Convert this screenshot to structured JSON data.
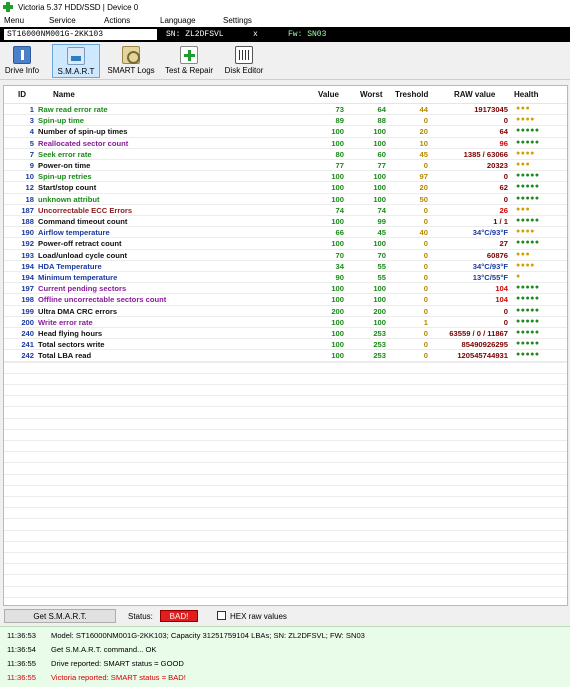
{
  "window": {
    "title": "Victoria 5.37 HDD/SSD | Device 0"
  },
  "menu": [
    "Menu",
    "Service",
    "Actions",
    "Language",
    "Settings"
  ],
  "device_bar": {
    "model": "ST16000NM001G-2KK103",
    "sn": "SN: ZL2DFSVL",
    "close": "x",
    "fw": "Fw: SN03"
  },
  "toolbar": [
    {
      "label": "Drive Info",
      "icon": "drive-icon",
      "active": false
    },
    {
      "label": "S.M.A.R.T",
      "icon": "smart-icon",
      "active": true
    },
    {
      "label": "SMART Logs",
      "icon": "logs-icon",
      "active": false
    },
    {
      "label": "Test & Repair",
      "icon": "repair-icon",
      "active": false
    },
    {
      "label": "Disk Editor",
      "icon": "editor-icon",
      "active": false
    }
  ],
  "columns": [
    "ID",
    "Name",
    "Value",
    "Worst",
    "Treshold",
    "RAW value",
    "Health"
  ],
  "colors": {
    "green": "#1a8a1a",
    "darkred": "#8b1a1a",
    "black": "#111111",
    "purple": "#8a1a9a",
    "blue": "#1a3aa0",
    "health_green": "#1a8a1a",
    "health_yellow": "#d4a000",
    "raw_default": "#7a0000",
    "raw_red": "#d40000",
    "raw_blue": "#1a3aa0"
  },
  "attributes": [
    {
      "id": "1",
      "name": "Raw read error rate",
      "value": "73",
      "worst": "64",
      "threshold": "44",
      "raw": "19173045",
      "health": "●●●",
      "name_color": "green",
      "raw_color": "raw_default",
      "health_color": "health_yellow"
    },
    {
      "id": "3",
      "name": "Spin-up time",
      "value": "89",
      "worst": "88",
      "threshold": "0",
      "raw": "0",
      "health": "●●●●",
      "name_color": "green",
      "raw_color": "raw_default",
      "health_color": "health_yellow"
    },
    {
      "id": "4",
      "name": "Number of spin-up times",
      "value": "100",
      "worst": "100",
      "threshold": "20",
      "raw": "64",
      "health": "●●●●●",
      "name_color": "black",
      "raw_color": "raw_default",
      "health_color": "health_green"
    },
    {
      "id": "5",
      "name": "Reallocated sector count",
      "value": "100",
      "worst": "100",
      "threshold": "10",
      "raw": "96",
      "health": "●●●●●",
      "name_color": "purple",
      "raw_color": "raw_red",
      "health_color": "health_green"
    },
    {
      "id": "7",
      "name": "Seek error rate",
      "value": "80",
      "worst": "60",
      "threshold": "45",
      "raw": "1385 / 63066",
      "health": "●●●●",
      "name_color": "green",
      "raw_color": "raw_default",
      "health_color": "health_yellow"
    },
    {
      "id": "9",
      "name": "Power-on time",
      "value": "77",
      "worst": "77",
      "threshold": "0",
      "raw": "20323",
      "health": "●●●",
      "name_color": "black",
      "raw_color": "raw_default",
      "health_color": "health_yellow"
    },
    {
      "id": "10",
      "name": "Spin-up retries",
      "value": "100",
      "worst": "100",
      "threshold": "97",
      "raw": "0",
      "health": "●●●●●",
      "name_color": "green",
      "raw_color": "raw_default",
      "health_color": "health_green"
    },
    {
      "id": "12",
      "name": "Start/stop count",
      "value": "100",
      "worst": "100",
      "threshold": "20",
      "raw": "62",
      "health": "●●●●●",
      "name_color": "black",
      "raw_color": "raw_default",
      "health_color": "health_green"
    },
    {
      "id": "18",
      "name": "unknown attribut",
      "value": "100",
      "worst": "100",
      "threshold": "50",
      "raw": "0",
      "health": "●●●●●",
      "name_color": "green",
      "raw_color": "raw_default",
      "health_color": "health_green"
    },
    {
      "id": "187",
      "name": "Uncorrectable ECC Errors",
      "value": "74",
      "worst": "74",
      "threshold": "0",
      "raw": "26",
      "health": "●●●",
      "name_color": "darkred",
      "raw_color": "raw_red",
      "health_color": "health_yellow"
    },
    {
      "id": "188",
      "name": "Command timeout count",
      "value": "100",
      "worst": "99",
      "threshold": "0",
      "raw": "1 / 1",
      "health": "●●●●●",
      "name_color": "black",
      "raw_color": "raw_default",
      "health_color": "health_green"
    },
    {
      "id": "190",
      "name": "Airflow temperature",
      "value": "66",
      "worst": "45",
      "threshold": "40",
      "raw": "34°C/93°F",
      "health": "●●●●",
      "name_color": "blue",
      "raw_color": "raw_blue",
      "health_color": "health_yellow"
    },
    {
      "id": "192",
      "name": "Power-off retract count",
      "value": "100",
      "worst": "100",
      "threshold": "0",
      "raw": "27",
      "health": "●●●●●",
      "name_color": "black",
      "raw_color": "raw_default",
      "health_color": "health_green"
    },
    {
      "id": "193",
      "name": "Load/unload cycle count",
      "value": "70",
      "worst": "70",
      "threshold": "0",
      "raw": "60876",
      "health": "●●●",
      "name_color": "black",
      "raw_color": "raw_default",
      "health_color": "health_yellow"
    },
    {
      "id": "194",
      "name": "HDA Temperature",
      "value": "34",
      "worst": "55",
      "threshold": "0",
      "raw": "34°C/93°F",
      "health": "●●●●",
      "name_color": "blue",
      "raw_color": "raw_blue",
      "health_color": "health_yellow"
    },
    {
      "id": "194",
      "name": "Minimum temperature",
      "value": "90",
      "worst": "55",
      "threshold": "0",
      "raw": "13°C/55°F",
      "health": "●",
      "name_color": "blue",
      "raw_color": "raw_blue",
      "health_color": "health_yellow"
    },
    {
      "id": "197",
      "name": "Current pending sectors",
      "value": "100",
      "worst": "100",
      "threshold": "0",
      "raw": "104",
      "health": "●●●●●",
      "name_color": "purple",
      "raw_color": "raw_red",
      "health_color": "health_green"
    },
    {
      "id": "198",
      "name": "Offline uncorrectable sectors count",
      "value": "100",
      "worst": "100",
      "threshold": "0",
      "raw": "104",
      "health": "●●●●●",
      "name_color": "purple",
      "raw_color": "raw_red",
      "health_color": "health_green"
    },
    {
      "id": "199",
      "name": "Ultra DMA CRC errors",
      "value": "200",
      "worst": "200",
      "threshold": "0",
      "raw": "0",
      "health": "●●●●●",
      "name_color": "black",
      "raw_color": "raw_default",
      "health_color": "health_green"
    },
    {
      "id": "200",
      "name": "Write error rate",
      "value": "100",
      "worst": "100",
      "threshold": "1",
      "raw": "0",
      "health": "●●●●●",
      "name_color": "purple",
      "raw_color": "raw_default",
      "health_color": "health_green"
    },
    {
      "id": "240",
      "name": "Head flying hours",
      "value": "100",
      "worst": "253",
      "threshold": "0",
      "raw": "63559 / 0 / 11867",
      "health": "●●●●●",
      "name_color": "black",
      "raw_color": "raw_default",
      "health_color": "health_green"
    },
    {
      "id": "241",
      "name": "Total sectors write",
      "value": "100",
      "worst": "253",
      "threshold": "0",
      "raw": "85490926295",
      "health": "●●●●●",
      "name_color": "black",
      "raw_color": "raw_default",
      "health_color": "health_green"
    },
    {
      "id": "242",
      "name": "Total LBA read",
      "value": "100",
      "worst": "253",
      "threshold": "0",
      "raw": "120545744931",
      "health": "●●●●●",
      "name_color": "black",
      "raw_color": "raw_default",
      "health_color": "health_green"
    }
  ],
  "statusbar": {
    "get_smart": "Get S.M.A.R.T.",
    "status_label": "Status:",
    "status_value": "BAD!",
    "hex_label": "HEX raw values"
  },
  "log": [
    {
      "time": "11:36:53",
      "text": "Model: ST16000NM001G-2KK103; Capacity 31251759104 LBAs; SN: ZL2DFSVL; FW: SN03",
      "color": "#000000"
    },
    {
      "time": "11:36:54",
      "text": "Get S.M.A.R.T. command... OK",
      "color": "#000000"
    },
    {
      "time": "11:36:55",
      "text": "Drive reported: SMART status = GOOD",
      "color": "#000000"
    },
    {
      "time": "11:36:55",
      "text": "Victoria reported: SMART status = BAD!",
      "color": "#d40000"
    }
  ]
}
